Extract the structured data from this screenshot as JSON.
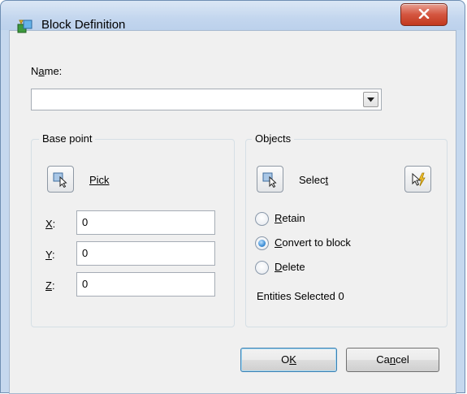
{
  "window": {
    "title": "Block Definition"
  },
  "name": {
    "label_prefix": "N",
    "label_underlined": "a",
    "label_suffix": "me:",
    "value": ""
  },
  "base_point": {
    "title": "Base point",
    "pick_label": "Pick",
    "x": {
      "label": "X",
      "value": "0"
    },
    "y": {
      "label": "Y",
      "value": "0"
    },
    "z": {
      "label": "Z",
      "value": "0"
    }
  },
  "objects": {
    "title": "Objects",
    "select_label_main": "Selec",
    "select_label_ul": "t",
    "options": [
      {
        "ul": "R",
        "rest": "etain",
        "checked": false
      },
      {
        "ul": "C",
        "rest": "onvert to block",
        "checked": true
      },
      {
        "ul": "D",
        "rest": "elete",
        "checked": false
      }
    ],
    "entities_selected": "Entities Selected 0"
  },
  "buttons": {
    "ok_main": "O",
    "ok_ul": "K",
    "cancel_pre": "Ca",
    "cancel_ul": "n",
    "cancel_post": "cel"
  },
  "colors": {
    "titlebar": "#c5d8ee",
    "client": "#f0f0f0",
    "close": "#c94a33",
    "radio_checked": "#3f8fd6"
  }
}
